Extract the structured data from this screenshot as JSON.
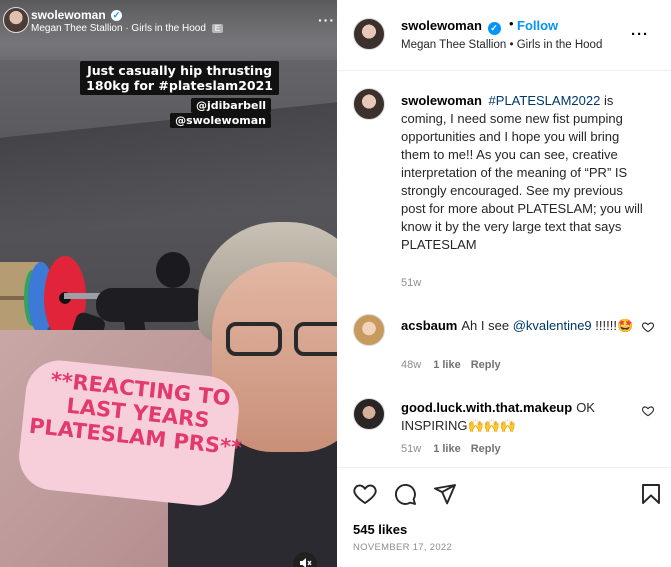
{
  "media": {
    "username": "swolewoman",
    "audio": "Megan Thee Stallion · Girls in the Hood",
    "explicit_badge": "E",
    "overlay_line1": "Just casually hip thrusting",
    "overlay_line2": "180kg for #plateslam2021",
    "tag1": "@jdibarbell",
    "tag2": "@swolewoman",
    "sticker": "**REACTING TO LAST YEARS PLATESLAM PRS**"
  },
  "header": {
    "username": "swolewoman",
    "verified": "✓",
    "dot": "•",
    "follow": "Follow",
    "audio": "Megan Thee Stallion • Girls in the Hood",
    "more": "···"
  },
  "caption": {
    "username": "swolewoman",
    "hashtag": "#PLATESLAM2022",
    "text": " is coming, I need some new fist pumping opportunities and I hope you will bring them to me!! As you can see, creative interpretation of the meaning of “PR” IS strongly encouraged. See my previous post for more about PLATESLAM; you will know it by the very large text that says PLATESLAM",
    "age": "51w"
  },
  "comments": [
    {
      "username": "acsbaum",
      "text_before": "Ah I see ",
      "mention": "@kvalentine9",
      "text_after": " !!!!!!🤩",
      "age": "48w",
      "likes": "1 like",
      "reply": "Reply"
    },
    {
      "username": "good.luck.with.that.makeup",
      "text": "OK INSPIRING🙌🙌🙌",
      "age": "51w",
      "likes": "1 like",
      "reply": "Reply"
    }
  ],
  "footer": {
    "likes": "545 likes",
    "date": "NOVEMBER 17, 2022"
  },
  "colors": {
    "accent": "#0095f6",
    "link": "#00376b",
    "muted": "#8e8e8e",
    "sticker_text": "#e23a6c",
    "sticker_bg": "#f7cfdb"
  },
  "icons": [
    "verified-icon",
    "more-icon",
    "like-icon",
    "comment-icon",
    "share-icon",
    "save-icon",
    "mute-icon"
  ]
}
